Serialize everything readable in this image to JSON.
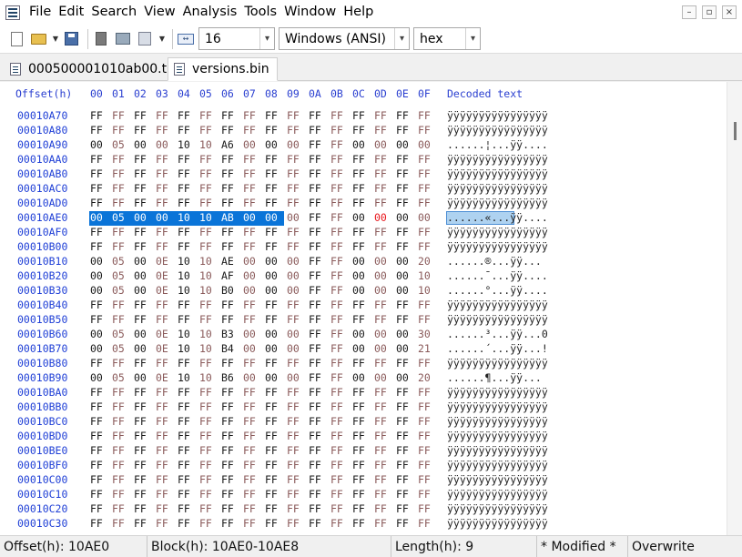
{
  "menu": {
    "items": [
      "File",
      "Edit",
      "Search",
      "View",
      "Analysis",
      "Tools",
      "Window",
      "Help"
    ]
  },
  "window_controls": {
    "minimize": "–",
    "restore": "▫",
    "close": "×"
  },
  "toolbar": {
    "bytes_per_row": "16",
    "charset": "Windows (ANSI)",
    "display_mode": "hex"
  },
  "tabs": [
    {
      "label": "000500001010ab00.tik",
      "active": false
    },
    {
      "label": "versions.bin",
      "active": true
    }
  ],
  "hex": {
    "offset_header": "Offset(h)",
    "column_headers": [
      "00",
      "01",
      "02",
      "03",
      "04",
      "05",
      "06",
      "07",
      "08",
      "09",
      "0A",
      "0B",
      "0C",
      "0D",
      "0E",
      "0F"
    ],
    "decoded_header": "Decoded text",
    "rows": [
      {
        "offset": "00010A70",
        "bytes": [
          "FF",
          "FF",
          "FF",
          "FF",
          "FF",
          "FF",
          "FF",
          "FF",
          "FF",
          "FF",
          "FF",
          "FF",
          "FF",
          "FF",
          "FF",
          "FF"
        ],
        "decoded": "ÿÿÿÿÿÿÿÿÿÿÿÿÿÿÿÿ"
      },
      {
        "offset": "00010A80",
        "bytes": [
          "FF",
          "FF",
          "FF",
          "FF",
          "FF",
          "FF",
          "FF",
          "FF",
          "FF",
          "FF",
          "FF",
          "FF",
          "FF",
          "FF",
          "FF",
          "FF"
        ],
        "decoded": "ÿÿÿÿÿÿÿÿÿÿÿÿÿÿÿÿ"
      },
      {
        "offset": "00010A90",
        "bytes": [
          "00",
          "05",
          "00",
          "00",
          "10",
          "10",
          "A6",
          "00",
          "00",
          "00",
          "FF",
          "FF",
          "00",
          "00",
          "00",
          "00"
        ],
        "decoded": "......¦...ÿÿ...."
      },
      {
        "offset": "00010AA0",
        "bytes": [
          "FF",
          "FF",
          "FF",
          "FF",
          "FF",
          "FF",
          "FF",
          "FF",
          "FF",
          "FF",
          "FF",
          "FF",
          "FF",
          "FF",
          "FF",
          "FF"
        ],
        "decoded": "ÿÿÿÿÿÿÿÿÿÿÿÿÿÿÿÿ"
      },
      {
        "offset": "00010AB0",
        "bytes": [
          "FF",
          "FF",
          "FF",
          "FF",
          "FF",
          "FF",
          "FF",
          "FF",
          "FF",
          "FF",
          "FF",
          "FF",
          "FF",
          "FF",
          "FF",
          "FF"
        ],
        "decoded": "ÿÿÿÿÿÿÿÿÿÿÿÿÿÿÿÿ"
      },
      {
        "offset": "00010AC0",
        "bytes": [
          "FF",
          "FF",
          "FF",
          "FF",
          "FF",
          "FF",
          "FF",
          "FF",
          "FF",
          "FF",
          "FF",
          "FF",
          "FF",
          "FF",
          "FF",
          "FF"
        ],
        "decoded": "ÿÿÿÿÿÿÿÿÿÿÿÿÿÿÿÿ"
      },
      {
        "offset": "00010AD0",
        "bytes": [
          "FF",
          "FF",
          "FF",
          "FF",
          "FF",
          "FF",
          "FF",
          "FF",
          "FF",
          "FF",
          "FF",
          "FF",
          "FF",
          "FF",
          "FF",
          "FF"
        ],
        "decoded": "ÿÿÿÿÿÿÿÿÿÿÿÿÿÿÿÿ"
      },
      {
        "offset": "00010AE0",
        "bytes": [
          "00",
          "05",
          "00",
          "00",
          "10",
          "10",
          "AB",
          "00",
          "00",
          "00",
          "FF",
          "FF",
          "00",
          "00",
          "00",
          "00"
        ],
        "decoded": "......«...ÿÿ....",
        "selected_count": 9,
        "red_index": 13
      },
      {
        "offset": "00010AF0",
        "bytes": [
          "FF",
          "FF",
          "FF",
          "FF",
          "FF",
          "FF",
          "FF",
          "FF",
          "FF",
          "FF",
          "FF",
          "FF",
          "FF",
          "FF",
          "FF",
          "FF"
        ],
        "decoded": "ÿÿÿÿÿÿÿÿÿÿÿÿÿÿÿÿ"
      },
      {
        "offset": "00010B00",
        "bytes": [
          "FF",
          "FF",
          "FF",
          "FF",
          "FF",
          "FF",
          "FF",
          "FF",
          "FF",
          "FF",
          "FF",
          "FF",
          "FF",
          "FF",
          "FF",
          "FF"
        ],
        "decoded": "ÿÿÿÿÿÿÿÿÿÿÿÿÿÿÿÿ"
      },
      {
        "offset": "00010B10",
        "bytes": [
          "00",
          "05",
          "00",
          "0E",
          "10",
          "10",
          "AE",
          "00",
          "00",
          "00",
          "FF",
          "FF",
          "00",
          "00",
          "00",
          "20"
        ],
        "decoded": "......®...ÿÿ... "
      },
      {
        "offset": "00010B20",
        "bytes": [
          "00",
          "05",
          "00",
          "0E",
          "10",
          "10",
          "AF",
          "00",
          "00",
          "00",
          "FF",
          "FF",
          "00",
          "00",
          "00",
          "10"
        ],
        "decoded": "......¯...ÿÿ...."
      },
      {
        "offset": "00010B30",
        "bytes": [
          "00",
          "05",
          "00",
          "0E",
          "10",
          "10",
          "B0",
          "00",
          "00",
          "00",
          "FF",
          "FF",
          "00",
          "00",
          "00",
          "10"
        ],
        "decoded": "......°...ÿÿ...."
      },
      {
        "offset": "00010B40",
        "bytes": [
          "FF",
          "FF",
          "FF",
          "FF",
          "FF",
          "FF",
          "FF",
          "FF",
          "FF",
          "FF",
          "FF",
          "FF",
          "FF",
          "FF",
          "FF",
          "FF"
        ],
        "decoded": "ÿÿÿÿÿÿÿÿÿÿÿÿÿÿÿÿ"
      },
      {
        "offset": "00010B50",
        "bytes": [
          "FF",
          "FF",
          "FF",
          "FF",
          "FF",
          "FF",
          "FF",
          "FF",
          "FF",
          "FF",
          "FF",
          "FF",
          "FF",
          "FF",
          "FF",
          "FF"
        ],
        "decoded": "ÿÿÿÿÿÿÿÿÿÿÿÿÿÿÿÿ"
      },
      {
        "offset": "00010B60",
        "bytes": [
          "00",
          "05",
          "00",
          "0E",
          "10",
          "10",
          "B3",
          "00",
          "00",
          "00",
          "FF",
          "FF",
          "00",
          "00",
          "00",
          "30"
        ],
        "decoded": "......³...ÿÿ...0"
      },
      {
        "offset": "00010B70",
        "bytes": [
          "00",
          "05",
          "00",
          "0E",
          "10",
          "10",
          "B4",
          "00",
          "00",
          "00",
          "FF",
          "FF",
          "00",
          "00",
          "00",
          "21"
        ],
        "decoded": "......´...ÿÿ...!"
      },
      {
        "offset": "00010B80",
        "bytes": [
          "FF",
          "FF",
          "FF",
          "FF",
          "FF",
          "FF",
          "FF",
          "FF",
          "FF",
          "FF",
          "FF",
          "FF",
          "FF",
          "FF",
          "FF",
          "FF"
        ],
        "decoded": "ÿÿÿÿÿÿÿÿÿÿÿÿÿÿÿÿ"
      },
      {
        "offset": "00010B90",
        "bytes": [
          "00",
          "05",
          "00",
          "0E",
          "10",
          "10",
          "B6",
          "00",
          "00",
          "00",
          "FF",
          "FF",
          "00",
          "00",
          "00",
          "20"
        ],
        "decoded": "......¶...ÿÿ... "
      },
      {
        "offset": "00010BA0",
        "bytes": [
          "FF",
          "FF",
          "FF",
          "FF",
          "FF",
          "FF",
          "FF",
          "FF",
          "FF",
          "FF",
          "FF",
          "FF",
          "FF",
          "FF",
          "FF",
          "FF"
        ],
        "decoded": "ÿÿÿÿÿÿÿÿÿÿÿÿÿÿÿÿ"
      },
      {
        "offset": "00010BB0",
        "bytes": [
          "FF",
          "FF",
          "FF",
          "FF",
          "FF",
          "FF",
          "FF",
          "FF",
          "FF",
          "FF",
          "FF",
          "FF",
          "FF",
          "FF",
          "FF",
          "FF"
        ],
        "decoded": "ÿÿÿÿÿÿÿÿÿÿÿÿÿÿÿÿ"
      },
      {
        "offset": "00010BC0",
        "bytes": [
          "FF",
          "FF",
          "FF",
          "FF",
          "FF",
          "FF",
          "FF",
          "FF",
          "FF",
          "FF",
          "FF",
          "FF",
          "FF",
          "FF",
          "FF",
          "FF"
        ],
        "decoded": "ÿÿÿÿÿÿÿÿÿÿÿÿÿÿÿÿ"
      },
      {
        "offset": "00010BD0",
        "bytes": [
          "FF",
          "FF",
          "FF",
          "FF",
          "FF",
          "FF",
          "FF",
          "FF",
          "FF",
          "FF",
          "FF",
          "FF",
          "FF",
          "FF",
          "FF",
          "FF"
        ],
        "decoded": "ÿÿÿÿÿÿÿÿÿÿÿÿÿÿÿÿ"
      },
      {
        "offset": "00010BE0",
        "bytes": [
          "FF",
          "FF",
          "FF",
          "FF",
          "FF",
          "FF",
          "FF",
          "FF",
          "FF",
          "FF",
          "FF",
          "FF",
          "FF",
          "FF",
          "FF",
          "FF"
        ],
        "decoded": "ÿÿÿÿÿÿÿÿÿÿÿÿÿÿÿÿ"
      },
      {
        "offset": "00010BF0",
        "bytes": [
          "FF",
          "FF",
          "FF",
          "FF",
          "FF",
          "FF",
          "FF",
          "FF",
          "FF",
          "FF",
          "FF",
          "FF",
          "FF",
          "FF",
          "FF",
          "FF"
        ],
        "decoded": "ÿÿÿÿÿÿÿÿÿÿÿÿÿÿÿÿ"
      },
      {
        "offset": "00010C00",
        "bytes": [
          "FF",
          "FF",
          "FF",
          "FF",
          "FF",
          "FF",
          "FF",
          "FF",
          "FF",
          "FF",
          "FF",
          "FF",
          "FF",
          "FF",
          "FF",
          "FF"
        ],
        "decoded": "ÿÿÿÿÿÿÿÿÿÿÿÿÿÿÿÿ"
      },
      {
        "offset": "00010C10",
        "bytes": [
          "FF",
          "FF",
          "FF",
          "FF",
          "FF",
          "FF",
          "FF",
          "FF",
          "FF",
          "FF",
          "FF",
          "FF",
          "FF",
          "FF",
          "FF",
          "FF"
        ],
        "decoded": "ÿÿÿÿÿÿÿÿÿÿÿÿÿÿÿÿ"
      },
      {
        "offset": "00010C20",
        "bytes": [
          "FF",
          "FF",
          "FF",
          "FF",
          "FF",
          "FF",
          "FF",
          "FF",
          "FF",
          "FF",
          "FF",
          "FF",
          "FF",
          "FF",
          "FF",
          "FF"
        ],
        "decoded": "ÿÿÿÿÿÿÿÿÿÿÿÿÿÿÿÿ"
      },
      {
        "offset": "00010C30",
        "bytes": [
          "FF",
          "FF",
          "FF",
          "FF",
          "FF",
          "FF",
          "FF",
          "FF",
          "FF",
          "FF",
          "FF",
          "FF",
          "FF",
          "FF",
          "FF",
          "FF"
        ],
        "decoded": "ÿÿÿÿÿÿÿÿÿÿÿÿÿÿÿÿ"
      }
    ]
  },
  "status": {
    "offset": "Offset(h): 10AE0",
    "block": "Block(h): 10AE0-10AE8",
    "length": "Length(h): 9",
    "modified": "* Modified *",
    "mode": "Overwrite"
  },
  "colors": {
    "offset_text": "#1f3fd6",
    "selection": "#0a74d8",
    "decoded_selection": "#aed2f0",
    "changed_byte": "#e8151b"
  }
}
